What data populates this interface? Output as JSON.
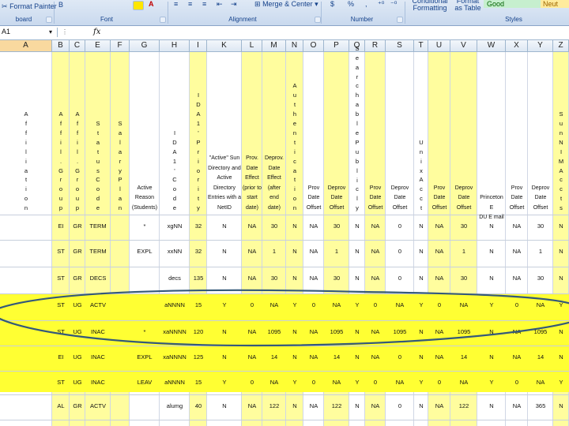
{
  "ribbon": {
    "format_painter": "Format Painter",
    "clipboard": "board",
    "font": "Font",
    "alignment": "Alignment",
    "merge_center": "Merge & Center",
    "number": "Number",
    "conditional_formatting": "Conditional Formatting",
    "format_as_table": "Format as Table",
    "styles": "Styles",
    "style_good": "Good",
    "style_neutral": "Neut",
    "currency_symbol": "$",
    "percent_symbol": "%"
  },
  "formula_bar": {
    "name_box": "A1",
    "fx": "fx",
    "formula": ""
  },
  "columns": [
    "A",
    "B",
    "C",
    "E",
    "F",
    "G",
    "H",
    "I",
    "K",
    "L",
    "M",
    "N",
    "O",
    "P",
    "Q",
    "R",
    "S",
    "T",
    "U",
    "V",
    "W",
    "X",
    "Y",
    "Z"
  ],
  "vertical_headers": [
    {
      "col": "A",
      "text": "Affiliation"
    },
    {
      "col": "B",
      "text": "A ff il . G ro u p"
    },
    {
      "col": "C",
      "text": "A ff il . G ro u p"
    },
    {
      "col": "E",
      "text": "Status Code"
    },
    {
      "col": "F",
      "text": "Salary Plan"
    },
    {
      "col": "H",
      "text": "IDA1' Code"
    },
    {
      "col": "I",
      "text": "IDA1' Priority"
    },
    {
      "col": "N",
      "text": "Authentication"
    },
    {
      "col": "Q",
      "text": "Searchable Publicly"
    },
    {
      "col": "T",
      "text": "Unix Acct"
    },
    {
      "col": "Z",
      "text": "Sun NIMAccts"
    }
  ],
  "horizontal_headers": [
    {
      "col": "G",
      "lines": [
        "Active",
        "Reason",
        "(Students)"
      ]
    },
    {
      "col": "K",
      "lines": [
        "\"Active\" Sun",
        "Directory and",
        "Active",
        "Directory",
        "Entries with a",
        "NetID"
      ]
    },
    {
      "col": "L",
      "lines": [
        "Prov.",
        "Date",
        "Effect",
        "(prior to",
        "start",
        "date)"
      ]
    },
    {
      "col": "M",
      "lines": [
        "Deprov.",
        "Date",
        "Effect",
        "(after",
        "end",
        "date)"
      ]
    },
    {
      "col": "O",
      "lines": [
        "Prov",
        "Date",
        "Offset"
      ]
    },
    {
      "col": "P",
      "lines": [
        "Deprov",
        "Date",
        "Offset"
      ]
    },
    {
      "col": "R",
      "lines": [
        "Prov",
        "Date",
        "Offset"
      ]
    },
    {
      "col": "S",
      "lines": [
        "Deprov",
        "Date",
        "Offset"
      ]
    },
    {
      "col": "U",
      "lines": [
        "Prov",
        "Date",
        "Offset"
      ]
    },
    {
      "col": "V",
      "lines": [
        "Deprov",
        "Date",
        "Offset"
      ]
    },
    {
      "col": "W",
      "lines": [
        "Princeton E",
        "DU E mail"
      ]
    },
    {
      "col": "X",
      "lines": [
        "Prov",
        "Date",
        "Offset"
      ]
    },
    {
      "col": "Y",
      "lines": [
        "Deprov",
        "Date",
        "Offset"
      ]
    }
  ],
  "rows": [
    [
      "EI",
      "GR",
      "TERM",
      "",
      "*",
      "xgNN",
      "32",
      "N",
      "NA",
      "30",
      "N",
      "NA",
      "30",
      "N",
      "NA",
      "0",
      "N",
      "NA",
      "30",
      "N",
      "NA",
      "30",
      "N"
    ],
    [
      "ST",
      "GR",
      "TERM",
      "",
      "EXPL",
      "xxNN",
      "32",
      "N",
      "NA",
      "1",
      "N",
      "NA",
      "1",
      "N",
      "NA",
      "0",
      "N",
      "NA",
      "1",
      "N",
      "NA",
      "1",
      "N"
    ],
    [
      "ST",
      "GR",
      "DECS",
      "",
      "",
      "decs",
      "135",
      "N",
      "NA",
      "30",
      "N",
      "NA",
      "30",
      "N",
      "NA",
      "0",
      "N",
      "NA",
      "30",
      "N",
      "NA",
      "30",
      "N"
    ],
    [
      "ST",
      "UG",
      "ACTV",
      "",
      "",
      "aNNNN",
      "15",
      "Y",
      "0",
      "NA",
      "Y",
      "0",
      "NA",
      "Y",
      "0",
      "NA",
      "Y",
      "0",
      "NA",
      "Y",
      "0",
      "NA",
      "Y"
    ],
    [
      "ST",
      "UG",
      "INAC",
      "",
      "*",
      "xaNNNN",
      "120",
      "N",
      "NA",
      "1095",
      "N",
      "NA",
      "1095",
      "N",
      "NA",
      "1095",
      "N",
      "NA",
      "1095",
      "N",
      "NA",
      "1095",
      "N"
    ],
    [
      "EI",
      "UG",
      "INAC",
      "",
      "EXPL",
      "xaNNNN",
      "125",
      "N",
      "NA",
      "14",
      "N",
      "NA",
      "14",
      "N",
      "NA",
      "0",
      "N",
      "NA",
      "14",
      "N",
      "NA",
      "14",
      "N"
    ],
    [
      "ST",
      "UG",
      "INAC",
      "",
      "LEAV",
      "aNNNN",
      "15",
      "Y",
      "0",
      "NA",
      "Y",
      "0",
      "NA",
      "Y",
      "0",
      "NA",
      "Y",
      "0",
      "NA",
      "Y",
      "0",
      "NA",
      "Y"
    ],
    [
      "AL",
      "GR",
      "ACTV",
      "",
      "",
      "alumg",
      "40",
      "N",
      "NA",
      "122",
      "N",
      "NA",
      "122",
      "N",
      "NA",
      "0",
      "N",
      "NA",
      "122",
      "N",
      "NA",
      "365",
      "N"
    ]
  ],
  "colors": {
    "highlight_yellow": "#ffff33",
    "light_yellow": "#fffd9e",
    "ellipse": "#34597a"
  }
}
